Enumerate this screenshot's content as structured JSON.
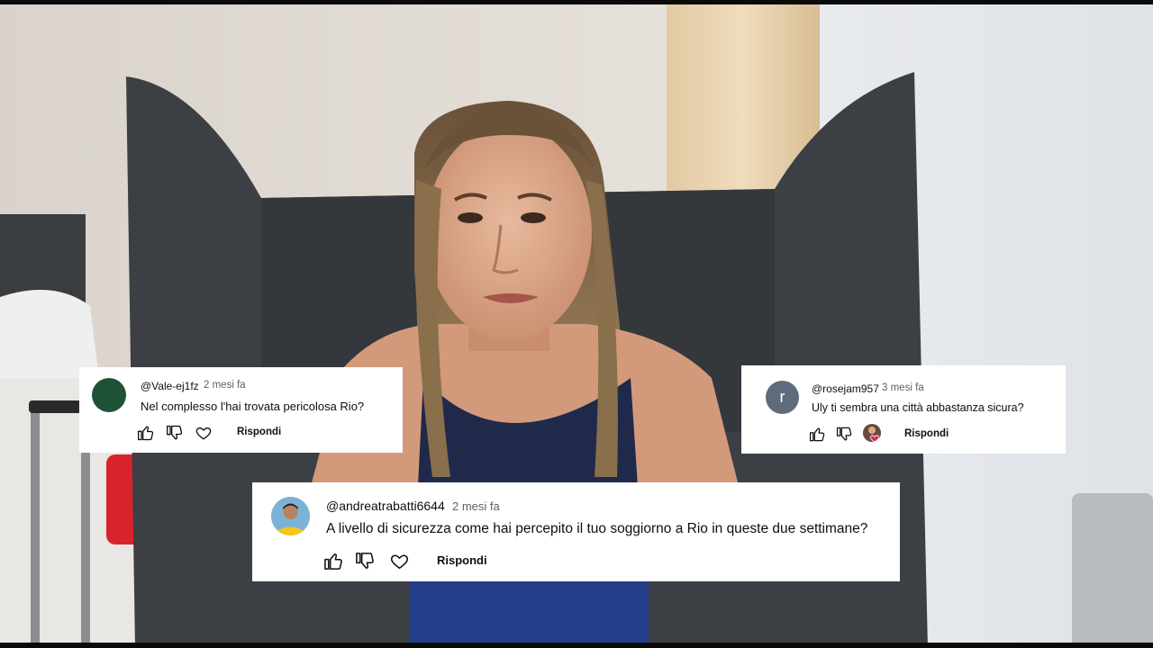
{
  "comments": [
    {
      "handle": "@Vale-ej1fz",
      "time": "2 mesi fa",
      "text": "Nel complesso l'hai trovata pericolosa Rio?",
      "reply_label": "Rispondi",
      "avatar_color": "#1e5236"
    },
    {
      "handle": "@rosejam957",
      "time": "3 mesi fa",
      "text": "Uly ti sembra una città abbastanza sicura?",
      "reply_label": "Rispondi",
      "avatar_letter": "r",
      "avatar_color": "#5f6b7a"
    },
    {
      "handle": "@andreatrabatti6644",
      "time": "2 mesi fa",
      "text": "A livello di sicurezza come hai percepito il tuo soggiorno a Rio in queste due settimane?",
      "reply_label": "Rispondi",
      "avatar_color": "#f6c61c"
    }
  ],
  "colors": {
    "card_bg": "#ffffff",
    "text": "#0f0f0f",
    "muted": "#606060",
    "heart_red": "#e0245e"
  }
}
